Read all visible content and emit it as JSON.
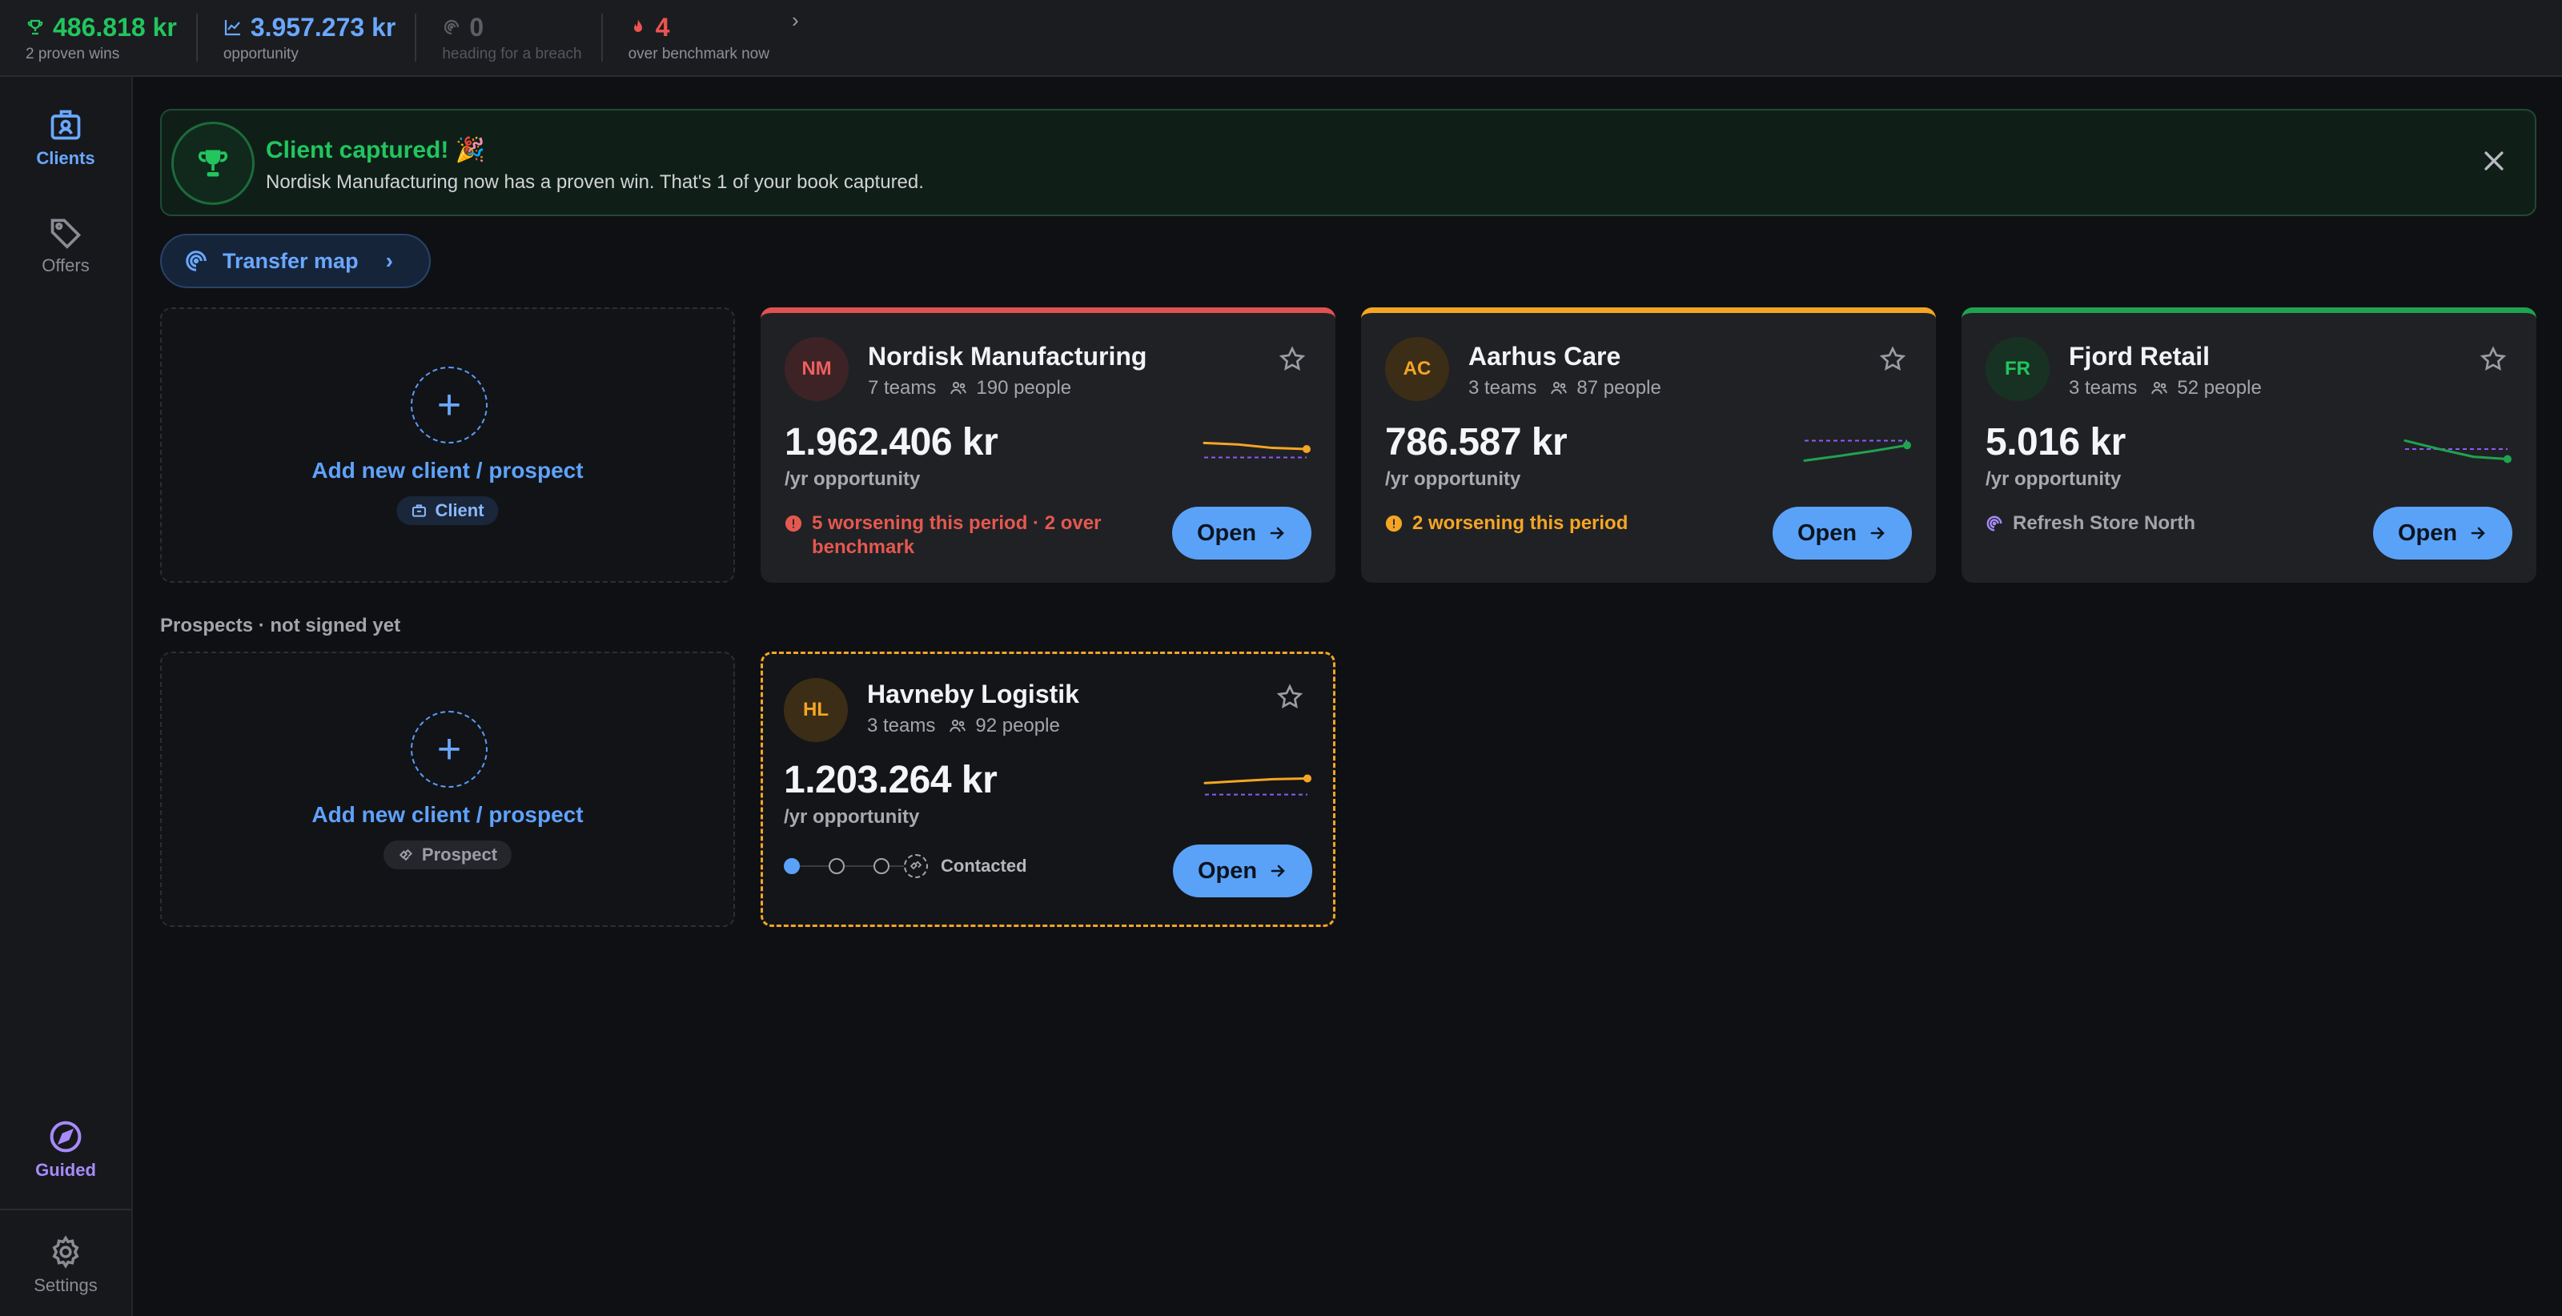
{
  "colors": {
    "accent_blue": "#5aa2f8",
    "success_green": "#22c55e",
    "warning_amber": "#f5a524",
    "danger_red": "#e05252",
    "guided_purple": "#a78bfa"
  },
  "topbar": {
    "wins": {
      "value": "486.818 kr",
      "label": "2 proven wins",
      "icon": "trophy-icon"
    },
    "opportunity": {
      "value": "3.957.273 kr",
      "label": "opportunity",
      "icon": "trend-up-icon"
    },
    "breach": {
      "value": "0",
      "label": "heading for a breach",
      "icon": "spiral-icon"
    },
    "benchmark": {
      "value": "4",
      "label": "over benchmark now",
      "icon": "flame-icon"
    }
  },
  "sidebar": {
    "items": [
      {
        "label": "Clients",
        "icon": "clients-icon"
      },
      {
        "label": "Offers",
        "icon": "tag-icon"
      },
      {
        "label": "Guided",
        "icon": "compass-icon"
      },
      {
        "label": "Settings",
        "icon": "gear-icon"
      }
    ]
  },
  "banner": {
    "title": "Client captured! 🎉",
    "message": "Nordisk Manufacturing now has a proven win. That's 1 of your book captured."
  },
  "transfer_map": {
    "label": "Transfer map"
  },
  "add_card": {
    "label": "Add new client / prospect",
    "client_pill": "Client",
    "prospect_pill": "Prospect"
  },
  "clients": [
    {
      "initials": "NM",
      "name": "Nordisk Manufacturing",
      "teams": "7 teams",
      "people": "190 people",
      "amount": "1.962.406 kr",
      "amount_sub": "/yr opportunity",
      "status": "5 worsening this period · 2 over benchmark",
      "open": "Open",
      "trend": [
        0.34,
        0.38,
        0.47,
        0.5
      ],
      "benchmark_level": 0.72
    },
    {
      "initials": "AC",
      "name": "Aarhus Care",
      "teams": "3 teams",
      "people": "87 people",
      "amount": "786.587 kr",
      "amount_sub": "/yr opportunity",
      "status": "2 worsening this period",
      "open": "Open",
      "trend": [
        0.8,
        0.68,
        0.55,
        0.4
      ],
      "benchmark_level": 0.28
    },
    {
      "initials": "FR",
      "name": "Fjord Retail",
      "teams": "3 teams",
      "people": "52 people",
      "amount": "5.016 kr",
      "amount_sub": "/yr opportunity",
      "status": "Refresh Store North",
      "open": "Open",
      "trend": [
        0.28,
        0.5,
        0.7,
        0.76
      ],
      "benchmark_level": 0.5
    }
  ],
  "prospects_label": "Prospects · not signed yet",
  "prospect": {
    "initials": "HL",
    "name": "Havneby Logistik",
    "teams": "3 teams",
    "people": "92 people",
    "amount": "1.203.264 kr",
    "amount_sub": "/yr opportunity",
    "stage": "Contacted",
    "open": "Open",
    "trend": [
      0.4,
      0.35,
      0.3,
      0.28
    ],
    "benchmark_level": 0.7
  }
}
